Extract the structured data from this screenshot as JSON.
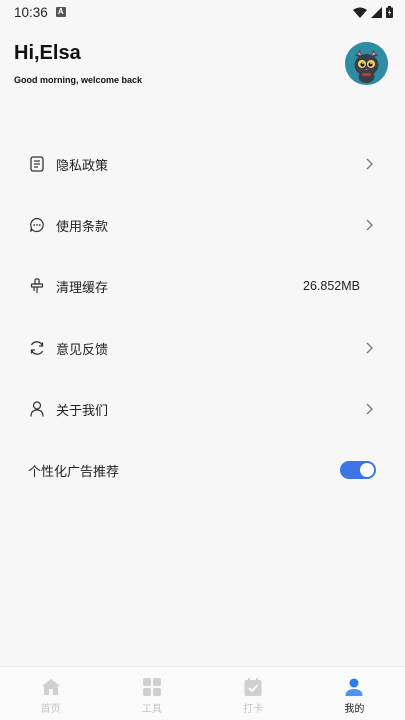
{
  "status_bar": {
    "time": "10:36",
    "notification_badge": "A"
  },
  "header": {
    "greeting": "Hi,Elsa",
    "subtitle": "Good morning, welcome back",
    "avatar_icon": "cat-avatar"
  },
  "menu": {
    "items": [
      {
        "label": "隐私政策",
        "icon": "document-icon"
      },
      {
        "label": "使用条款",
        "icon": "chat-bubble-icon"
      },
      {
        "label": "清理缓存",
        "icon": "broom-icon",
        "value": "26.852MB"
      },
      {
        "label": "意见反馈",
        "icon": "refresh-icon"
      },
      {
        "label": "关于我们",
        "icon": "person-icon"
      }
    ],
    "ad_toggle": {
      "label": "个性化广告推荐",
      "enabled": true
    }
  },
  "bottom_nav": {
    "tabs": [
      {
        "label": "首页",
        "icon": "home-icon",
        "active": false
      },
      {
        "label": "工具",
        "icon": "grid-icon",
        "active": false
      },
      {
        "label": "打卡",
        "icon": "calendar-check-icon",
        "active": false
      },
      {
        "label": "我的",
        "icon": "user-icon",
        "active": true
      }
    ]
  },
  "colors": {
    "accent": "#3d74e6",
    "background": "#f7f7f7",
    "inactive_nav": "#c4c4c4"
  }
}
